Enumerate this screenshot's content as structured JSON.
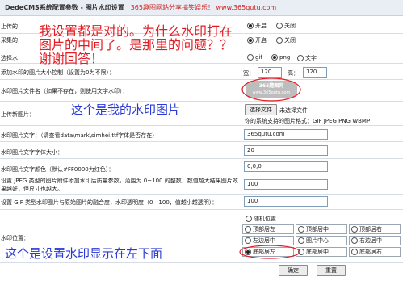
{
  "title": {
    "app": "DedeCMS系统配置参数 - 图片水印设置",
    "ad": "365趣图网站分享搞笑娱乐！ www.365qutu.com"
  },
  "labels": {
    "row_1": "上传的",
    "row_2": "采集的",
    "row_3": "选择水",
    "row_4": "添加水印的图片大小控制（设置为0为不限）：",
    "row_wm_file": "水印图片文件名（如果不存在，则使用文字水印）：",
    "row_upload": "上传新图片：",
    "row_text": "水印图片文字：（请查看data\\mark\\simhei.ttf字体是否存在）",
    "row_font_size": "水印图片文字字体大小：",
    "row_font_color": "水印图片文字颜色（默认#FF0000为红色）：",
    "row_jpeg": "设置 JPEG 类型的图片附件添加水印后质量参数，范围为 0~100 的整数，数值越大结果图片效果越好，但尺寸也越大。",
    "row_gif": "设置 GIF 类型水印图片与原始图片的融合度，水印透明度（0—100，值越小越透明）：",
    "row_position": "水印位置："
  },
  "options": {
    "on": "开启",
    "off": "关闭",
    "gif": "gif",
    "png": "png",
    "text": "文字",
    "width_label": "宽：",
    "height_label": "高：",
    "random": "随机位置",
    "top_left": "顶部居左",
    "top_center": "顶部居中",
    "top_right": "顶部居右",
    "mid_left": "左边居中",
    "mid_center": "图片中心",
    "mid_right": "右边居中",
    "bottom_left": "底部居左",
    "bottom_center": "底部居中",
    "bottom_right": "底部居右"
  },
  "fields": {
    "width": "120",
    "height": "120",
    "file_button": "选择文件",
    "file_status": "未选择文件",
    "supported_formats": "你的系统支持的图片格式：GIF JPEG PNG WBMP",
    "text_value": "365qutu.com",
    "font_size": "20",
    "font_color": "0,0,0",
    "jpeg_quality": "100",
    "gif_opacity": "100"
  },
  "watermark": {
    "line1": "365趣图网",
    "line2": "www.365qutu.com"
  },
  "buttons": {
    "submit": "确定",
    "reset": "重置"
  },
  "annotations": {
    "question": "我设置都是对的。为什么水印打在图片的中间了。是那里的问题？？谢谢回答！",
    "watermark_note": "这个是我的水印图片",
    "position_note": "这个是设置水印显示在左下面"
  }
}
